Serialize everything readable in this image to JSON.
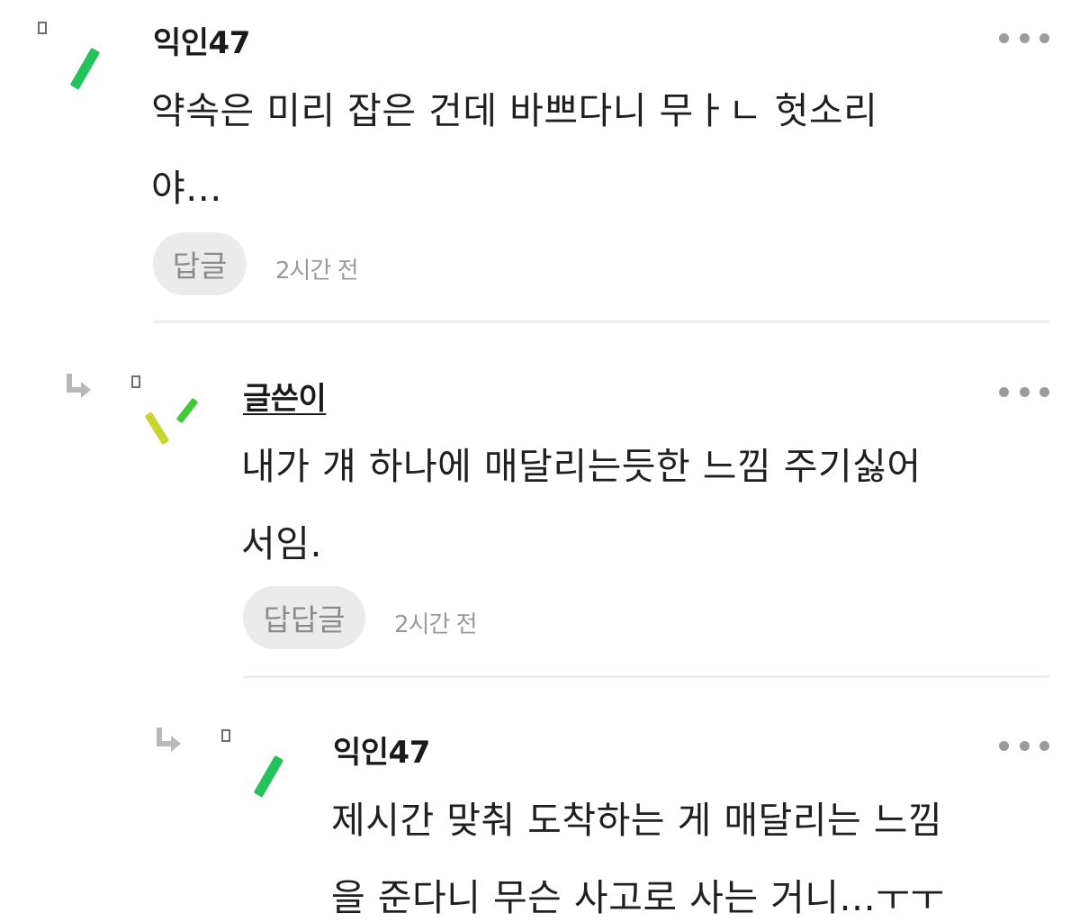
{
  "comments": [
    {
      "nickname": "익인47",
      "text_line1": "약속은 미리 잡은 건데 바쁘다니 무ㅏㄴ 헛소리",
      "text_line2": "야...",
      "reply_label": "답글",
      "time": "2시간 전",
      "accent": "#23c25a"
    },
    {
      "nickname": "글쓴이",
      "text_line1": "내가 걔 하나에 매달리는듯한 느낌 주기싫어",
      "text_line2": "서임.",
      "reply_label": "답답글",
      "time": "2시간 전",
      "accent": "#45c93b"
    },
    {
      "nickname": "익인47",
      "text_line1": "제시간 맞춰 도착하는 게 매달리는 느낌",
      "text_line2": "을 준다니 무슨 사고로 사는 거니...ㅜㅜ",
      "accent": "#23c25a"
    }
  ]
}
